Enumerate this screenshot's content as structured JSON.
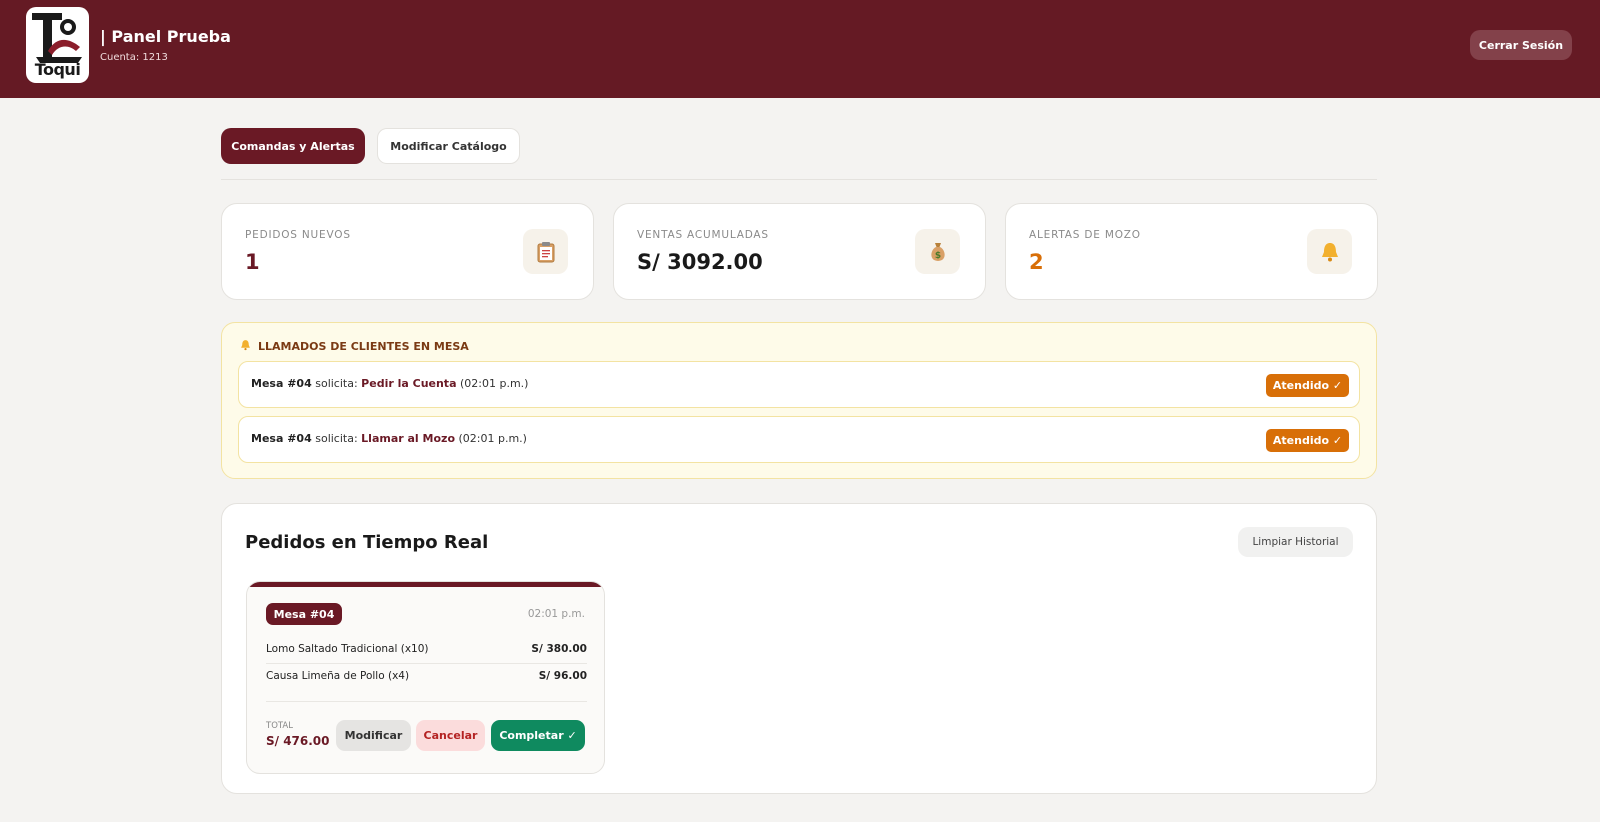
{
  "header": {
    "logo_text": "Toqui",
    "title": "| Panel Prueba",
    "account": "Cuenta: 1213",
    "logout_label": "Cerrar Sesión"
  },
  "tabs": [
    {
      "label": "Comandas y Alertas",
      "active": true
    },
    {
      "label": "Modificar Catálogo",
      "active": false
    }
  ],
  "stats": [
    {
      "label": "PEDIDOS NUEVOS",
      "value": "1",
      "icon": "clipboard-icon",
      "color": "#6a1925"
    },
    {
      "label": "VENTAS ACUMULADAS",
      "value": "S/ 3092.00",
      "icon": "money-bag-icon",
      "color": "#1a1a1a"
    },
    {
      "label": "ALERTAS DE MOZO",
      "value": "2",
      "icon": "bell-icon",
      "color": "#d86f08"
    }
  ],
  "alerts": {
    "title": "LLAMADOS DE CLIENTES EN MESA",
    "items": [
      {
        "table": "Mesa #04",
        "verb": "solicita:",
        "request": "Pedir la Cuenta",
        "time": "(02:01 p.m.)",
        "button": "Atendido ✓"
      },
      {
        "table": "Mesa #04",
        "verb": "solicita:",
        "request": "Llamar al Mozo",
        "time": "(02:01 p.m.)",
        "button": "Atendido ✓"
      }
    ]
  },
  "orders": {
    "title": "Pedidos en Tiempo Real",
    "clear_label": "Limpiar Historial",
    "cards": [
      {
        "table": "Mesa #04",
        "time": "02:01 p.m.",
        "items": [
          {
            "name": "Lomo Saltado Tradicional (x10)",
            "price": "S/ 380.00"
          },
          {
            "name": "Causa Limeña de Pollo (x4)",
            "price": "S/ 96.00"
          }
        ],
        "total_label": "TOTAL",
        "total": "S/ 476.00",
        "buttons": {
          "modify": "Modificar",
          "cancel": "Cancelar",
          "complete": "Completar ✓"
        }
      }
    ]
  },
  "colors": {
    "brand": "#651a24",
    "accent": "#6a1925",
    "alert_orange": "#d86f08",
    "success": "#0f8a5f"
  }
}
